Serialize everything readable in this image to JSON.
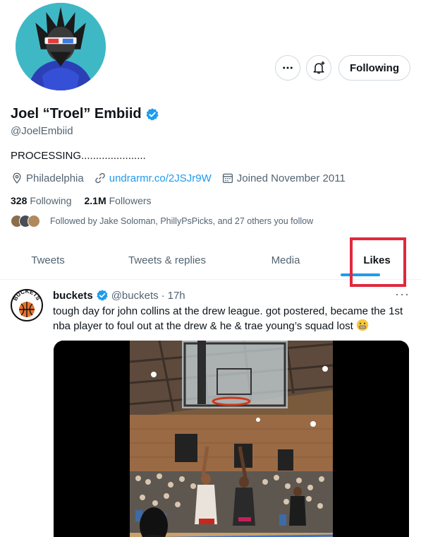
{
  "profile": {
    "display_name": "Joel “Troel” Embiid",
    "handle": "@JoelEmbiid",
    "bio": "PROCESSING......................",
    "location": "Philadelphia",
    "website": "undrarmr.co/2JSJr9W",
    "joined": "Joined November 2011",
    "following_count": "328",
    "following_label": "Following",
    "followers_count": "2.1M",
    "followers_label": "Followers",
    "followed_by": "Followed by Jake Soloman, PhillyPsPicks, and 27 others you follow",
    "following_button": "Following"
  },
  "tabs": {
    "tweets": "Tweets",
    "replies": "Tweets & replies",
    "media": "Media",
    "likes": "Likes"
  },
  "tweet": {
    "name": "buckets",
    "handle": "@buckets",
    "dot": "·",
    "time": "17h",
    "more": "···",
    "text": "tough day for john collins at the drew league. got postered, became the 1st nba player to foul out at the drew & he & trae young’s squad lost",
    "avatar_text": "BUCKETS"
  },
  "colors": {
    "accent": "#1d9bf0",
    "highlight": "#e0283d",
    "avatar_bg": "#3fb8c6"
  },
  "icons": {
    "more": "more-horizontal-icon",
    "bell": "notification-bell-plus-icon",
    "verified": "verified-badge-icon",
    "location": "location-pin-icon",
    "link": "link-icon",
    "calendar": "calendar-icon",
    "emoji": "grimacing-face-emoji"
  }
}
